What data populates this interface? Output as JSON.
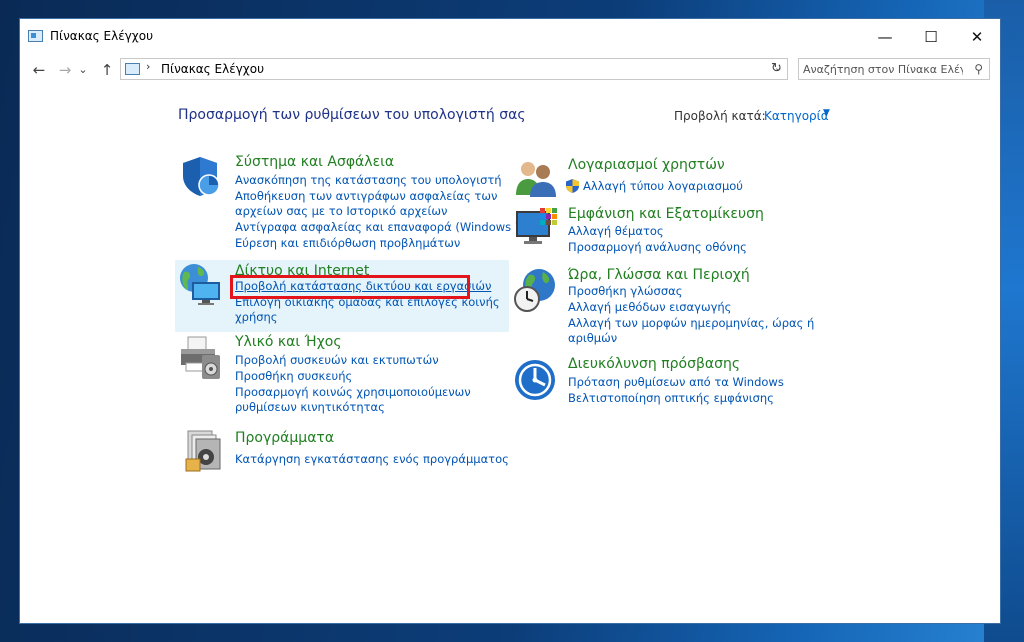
{
  "window": {
    "title": "Πίνακας Ελέγχου",
    "controls": {
      "minimize": "—",
      "maximize": "☐",
      "close": "✕"
    }
  },
  "address": {
    "nav": {
      "back": "←",
      "forward": "→",
      "recent": "⌄",
      "up": "↑"
    },
    "separator": "›",
    "path": "Πίνακας Ελέγχου",
    "dropdown": "⌄",
    "refresh": "↻",
    "search_placeholder": "Αναζήτηση στον Πίνακα Ελέγ...",
    "search_glyph": "⚲"
  },
  "main": {
    "heading": "Προσαρμογή των ρυθμίσεων του υπολογιστή σας",
    "view_by_label": "Προβολή κατά:",
    "view_by_value": "Κατηγορία",
    "view_by_caret": "▼"
  },
  "categories": {
    "system": {
      "title": "Σύστημα και Ασφάλεια",
      "links": [
        "Ανασκόπηση της κατάστασης του υπολογιστή",
        "Αποθήκευση των αντιγράφων ασφαλείας των",
        "αρχείων σας με το Ιστορικό αρχείων",
        "Αντίγραφα ασφαλείας και επαναφορά (Windows 7)",
        "Εύρεση και επιδιόρθωση προβλημάτων"
      ]
    },
    "network": {
      "title": "Δίκτυο και Internet",
      "links": [
        "Προβολή κατάστασης δικτύου και εργασιών",
        "Επιλογή οικιακής ομάδας και επιλογές κοινής",
        "χρήσης"
      ]
    },
    "hardware": {
      "title": "Υλικό και Ήχος",
      "links": [
        "Προβολή συσκευών και εκτυπωτών",
        "Προσθήκη συσκευής",
        "Προσαρμογή κοινώς χρησιμοποιούμενων",
        "ρυθμίσεων κινητικότητας"
      ]
    },
    "programs": {
      "title": "Προγράμματα",
      "links": [
        "Κατάργηση εγκατάστασης ενός προγράμματος"
      ]
    },
    "accounts": {
      "title": "Λογαριασμοί χρηστών",
      "links": [
        "Αλλαγή τύπου λογαριασμού"
      ]
    },
    "appearance": {
      "title": "Εμφάνιση και Εξατομίκευση",
      "links": [
        "Αλλαγή θέματος",
        "Προσαρμογή ανάλυσης οθόνης"
      ]
    },
    "clock": {
      "title": "Ώρα, Γλώσσα και Περιοχή",
      "links": [
        "Προσθήκη γλώσσας",
        "Αλλαγή μεθόδων εισαγωγής",
        "Αλλαγή των μορφών ημερομηνίας, ώρας ή",
        "αριθμών"
      ]
    },
    "access": {
      "title": "Διευκόλυνση πρόσβασης",
      "links": [
        "Πρόταση ρυθμίσεων από τα Windows",
        "Βελτιστοποίηση οπτικής εμφάνισης"
      ]
    }
  },
  "colors": {
    "category_title": "#217f21",
    "link": "#0054b3",
    "heading": "#1e3287",
    "highlight_box": "#e3151a",
    "hover_background": "#e5f3fb"
  }
}
